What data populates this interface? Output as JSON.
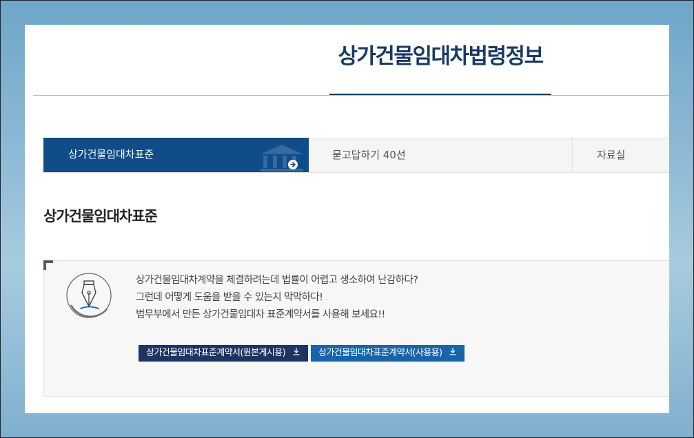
{
  "header": {
    "title": "상가건물임대차법령정보"
  },
  "tabs": [
    {
      "label": "상가건물임대차표준",
      "active": true
    },
    {
      "label": "묻고답하기 40선",
      "active": false
    },
    {
      "label": "자료실",
      "active": false
    }
  ],
  "section": {
    "title": "상가건물임대차표준",
    "lines": [
      "상가건물임대차계약을 체결하려는데 법률이 어렵고 생소하여 난감하다?",
      "그런데 어떻게 도움을 받을 수 있는지 막막하다!",
      "법무부에서 만든 상가건물임대차 표준계약서를 사용해 보세요!!"
    ],
    "downloads": [
      {
        "label": "상가건물임대차표준계약서(원본게시용)"
      },
      {
        "label": "상가건물임대차표준계약서(사용용)"
      }
    ]
  },
  "colors": {
    "primary_navy": "#173a66",
    "tab_active": "#0f4c8a",
    "button_dark": "#1e3463",
    "button_blue": "#1864a9"
  },
  "icons": {
    "tab_background": "building-icon",
    "tab_arrow": "arrow-right-circle-icon",
    "feature": "fountain-pen-icon",
    "download": "download-icon"
  }
}
